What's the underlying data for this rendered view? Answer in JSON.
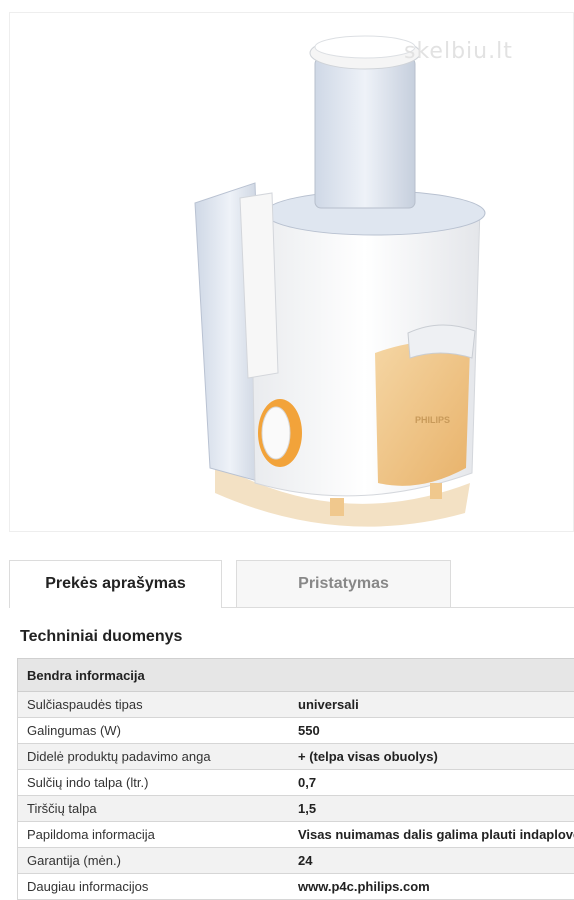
{
  "watermark": "skelbiu.lt",
  "product_image": {
    "brand_label": "PHILIPS",
    "colors": {
      "body": "#f6f6f6",
      "accent": "#f2c98a",
      "knob": "#f2a33a",
      "transparent": "#dfe6f0"
    }
  },
  "tabs": [
    {
      "label": "Prekės aprašymas",
      "active": true
    },
    {
      "label": "Pristatymas",
      "active": false
    }
  ],
  "section_title": "Techniniai duomenys",
  "specs": {
    "group": "Bendra informacija",
    "rows": [
      {
        "label": "Sulčiaspaudės tipas",
        "value": "universali"
      },
      {
        "label": "Galingumas (W)",
        "value": "550"
      },
      {
        "label": "Didelė produktų padavimo anga",
        "value": "+ (telpa visas obuolys)"
      },
      {
        "label": "Sulčių indo talpa (ltr.)",
        "value": "0,7"
      },
      {
        "label": "Tirščių talpa",
        "value": "1,5"
      },
      {
        "label": "Papildoma informacija",
        "value": "Visas nuimamas dalis galima plauti indaplovėje"
      },
      {
        "label": "Garantija (mėn.)",
        "value": "24"
      },
      {
        "label": "Daugiau informacijos",
        "value": "www.p4c.philips.com"
      }
    ]
  }
}
